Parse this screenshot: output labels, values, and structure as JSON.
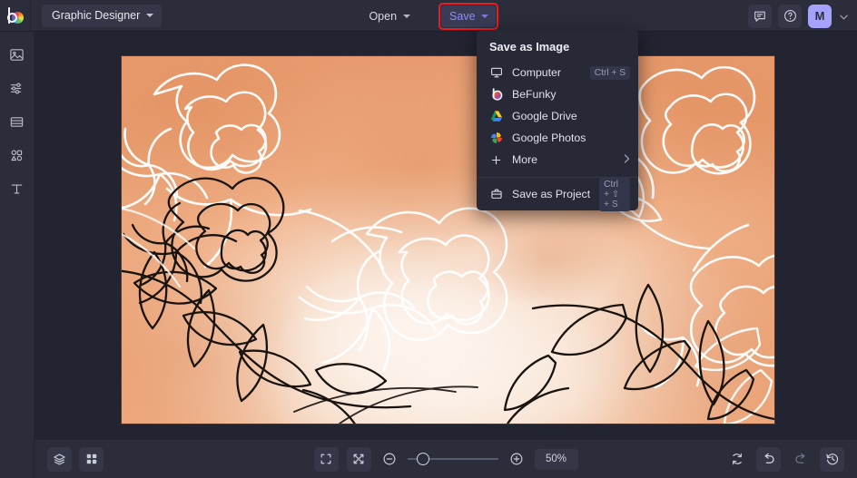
{
  "header": {
    "logo_name": "befunky-logo",
    "workspace": {
      "label": "Graphic Designer",
      "icon": "chevron-down-icon"
    },
    "open_button": {
      "label": "Open",
      "icon": "chevron-down-icon"
    },
    "save_button": {
      "label": "Save",
      "icon": "chevron-down-icon",
      "highlight_color": "#ec1c24",
      "text_color": "#8e8bf5"
    },
    "feedback_icon": "speech-bubble-icon",
    "help_icon": "question-circle-icon",
    "avatar": {
      "initial": "M",
      "color": "#a5a2fb"
    },
    "avatar_chevron": "chevron-down-icon"
  },
  "sidebar": {
    "items": [
      {
        "name": "image-manager",
        "icon": "image-icon"
      },
      {
        "name": "edit-adjust",
        "icon": "sliders-icon"
      },
      {
        "name": "templates",
        "icon": "layout-icon"
      },
      {
        "name": "graphics",
        "icon": "shapes-icon"
      },
      {
        "name": "text",
        "icon": "text-icon"
      }
    ]
  },
  "save_menu": {
    "title": "Save as Image",
    "items": [
      {
        "label": "Computer",
        "icon": "monitor-icon",
        "shortcut": "Ctrl + S"
      },
      {
        "label": "BeFunky",
        "icon": "befunky-icon",
        "shortcut": ""
      },
      {
        "label": "Google Drive",
        "icon": "google-drive-icon",
        "shortcut": ""
      },
      {
        "label": "Google Photos",
        "icon": "google-photos-icon",
        "shortcut": ""
      },
      {
        "label": "More",
        "icon": "plus-icon",
        "shortcut": "",
        "arrow": "chevron-right-icon"
      }
    ],
    "project_item": {
      "label": "Save as Project",
      "icon": "briefcase-icon",
      "shortcut": "Ctrl + ⇧ + S"
    }
  },
  "canvas": {
    "artwork_name": "watercolor-floral-line-art",
    "background_color": "#efa87a",
    "line_colors": {
      "white": "#ffffff",
      "black": "#17120f"
    }
  },
  "bottom_bar": {
    "layers_icon": "layers-icon",
    "grid_icon": "grid-icon",
    "fit_icon": "fit-to-screen-icon",
    "actual_icon": "zoom-contract-icon",
    "zoom_out_icon": "minus-circle-icon",
    "zoom_in_icon": "plus-circle-icon",
    "zoom_value": "50%",
    "zoom_percent": 50,
    "reset_icon": "reset-icon",
    "undo_icon": "undo-icon",
    "redo_icon": "redo-icon",
    "history_icon": "history-icon"
  }
}
